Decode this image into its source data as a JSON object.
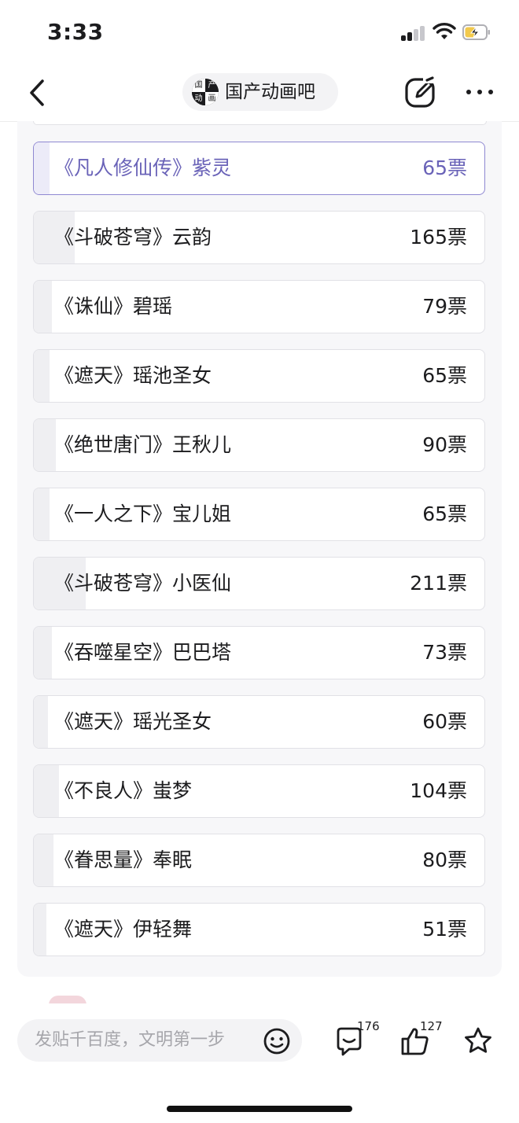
{
  "status_bar": {
    "time": "3:33"
  },
  "nav": {
    "forum_name": "国产动画吧",
    "logo_chars": [
      "国",
      "产",
      "动",
      "画"
    ]
  },
  "poll": {
    "options": [
      {
        "label": "《凡人修仙传》紫灵",
        "votes": "65票",
        "share": 0.035,
        "selected": true
      },
      {
        "label": "《斗破苍穹》云韵",
        "votes": "165票",
        "share": 0.09,
        "selected": false
      },
      {
        "label": "《诛仙》碧瑶",
        "votes": "79票",
        "share": 0.04,
        "selected": false
      },
      {
        "label": "《遮天》瑶池圣女",
        "votes": "65票",
        "share": 0.035,
        "selected": false
      },
      {
        "label": "《绝世唐门》王秋儿",
        "votes": "90票",
        "share": 0.048,
        "selected": false
      },
      {
        "label": "《一人之下》宝儿姐",
        "votes": "65票",
        "share": 0.035,
        "selected": false
      },
      {
        "label": "《斗破苍穹》小医仙",
        "votes": "211票",
        "share": 0.115,
        "selected": false
      },
      {
        "label": "《吞噬星空》巴巴塔",
        "votes": "73票",
        "share": 0.04,
        "selected": false
      },
      {
        "label": "《遮天》瑶光圣女",
        "votes": "60票",
        "share": 0.032,
        "selected": false
      },
      {
        "label": "《不良人》蚩梦",
        "votes": "104票",
        "share": 0.056,
        "selected": false
      },
      {
        "label": "《眷思量》奉眠",
        "votes": "80票",
        "share": 0.043,
        "selected": false
      },
      {
        "label": "《遮天》伊轻舞",
        "votes": "51票",
        "share": 0.028,
        "selected": false
      }
    ]
  },
  "bottom_bar": {
    "reply_placeholder": "发贴千百度，文明第一步",
    "comment_count": "176",
    "like_count": "127"
  },
  "colors": {
    "accent": "#6a63b8",
    "selected_border": "#8f88d2"
  }
}
